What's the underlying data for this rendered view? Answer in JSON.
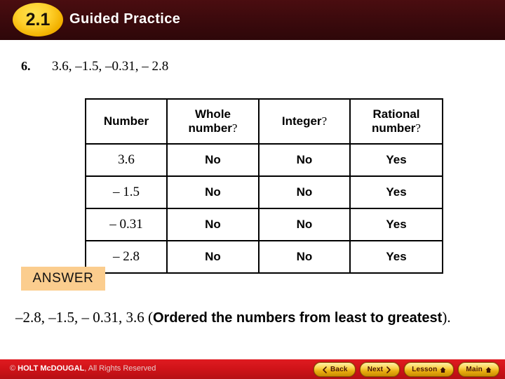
{
  "header": {
    "lesson_badge": "2.1",
    "title": "Guided Practice",
    "background_color": "#3d0a0d",
    "badge_color": "#ffd12e"
  },
  "problem": {
    "number": "6.",
    "values": "3.6, –1.5, –0.31, – 2.8"
  },
  "table": {
    "columns": [
      {
        "label": "Number",
        "suffix": ""
      },
      {
        "label": "Whole",
        "label2": "number",
        "suffix": "?"
      },
      {
        "label": "Integer",
        "suffix": "?"
      },
      {
        "label": "Rational",
        "label2": "number",
        "suffix": "?"
      }
    ],
    "rows": [
      {
        "number": "3.6",
        "whole": "No",
        "integer": "No",
        "rational": "Yes"
      },
      {
        "number": "– 1.5",
        "whole": "No",
        "integer": "No",
        "rational": "Yes"
      },
      {
        "number": "– 0.31",
        "whole": "No",
        "integer": "No",
        "rational": "Yes"
      },
      {
        "number": "– 2.8",
        "whole": "No",
        "integer": "No",
        "rational": "Yes"
      }
    ]
  },
  "answer": {
    "chip_label": "ANSWER",
    "chip_color": "#fbcd8e",
    "values": "–2.8, –1.5, – 0.31, 3.6 (",
    "explanation": "Ordered the numbers from least to greatest",
    "closing": ")."
  },
  "footer": {
    "copyright_symbol": "© ",
    "copyright_brand": "HOLT McDOUGAL",
    "copyright_rest": ", All Rights Reserved",
    "background_color": "#cf1318",
    "buttons": [
      {
        "label": "Back",
        "icon": "chevron-left-icon",
        "icon_side": "left"
      },
      {
        "label": "Next",
        "icon": "chevron-right-icon",
        "icon_side": "right"
      },
      {
        "label": "Lesson",
        "icon": "home-icon",
        "icon_side": "right"
      },
      {
        "label": "Main",
        "icon": "home-icon",
        "icon_side": "right"
      }
    ]
  }
}
